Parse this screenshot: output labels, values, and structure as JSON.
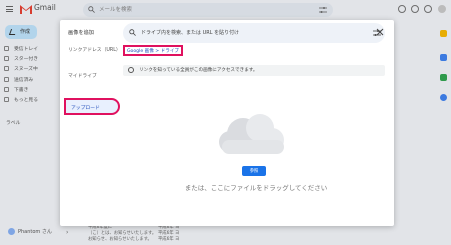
{
  "gmail": {
    "app_name": "Gmail",
    "search_placeholder": "メールを検索",
    "compose_label": "作成",
    "nav": [
      "受信トレイ",
      "スター付き",
      "スヌーズ中",
      "送信済み",
      "下書き",
      "もっと見る"
    ],
    "labels_heading": "ラベル",
    "account_label": "Phantom さん",
    "bg_rows": [
      {
        "text": "平成6年度に",
        "date": "平成6年 ヨ"
      },
      {
        "text": "（こ）とは、お知らせいたします。",
        "date": "平成6年 ヨ"
      },
      {
        "text": "お知らせ、お知らせいたします。",
        "date": "平成6年 ヨ"
      }
    ]
  },
  "dialog": {
    "title": "画像を追加",
    "left_items": [
      "リンクアドレス（URL）",
      "マイドライブ"
    ],
    "upload_tab": "アップロード",
    "search_placeholder": "ドライブ内を検索、または URL を貼り付け",
    "breadcrumb": "Google 画像 > ドライブ",
    "info_text": "リンクを知っている全員がこの画像にアクセスできます。",
    "upload_button": "参照",
    "drag_text": "または、ここにファイルをドラッグしてください"
  },
  "colors": {
    "highlight": "#e0115f",
    "accent": "#1a73e8",
    "compose_bg": "#c2e7ff"
  }
}
